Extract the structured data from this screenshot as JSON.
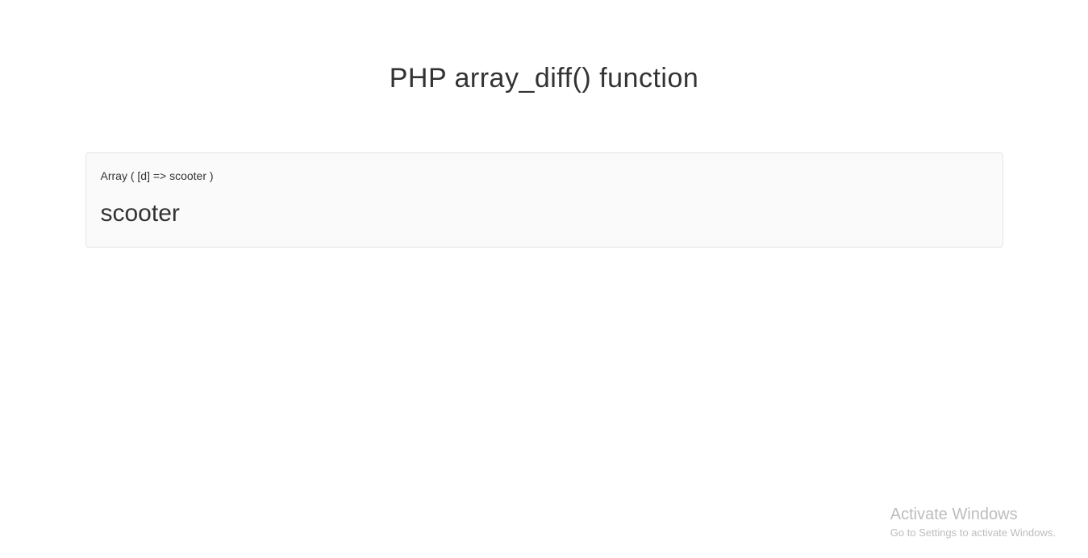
{
  "title": "PHP array_diff() function",
  "output": {
    "array_print": "Array ( [d] => scooter )",
    "value": "scooter"
  },
  "watermark": {
    "title": "Activate Windows",
    "subtitle": "Go to Settings to activate Windows."
  }
}
